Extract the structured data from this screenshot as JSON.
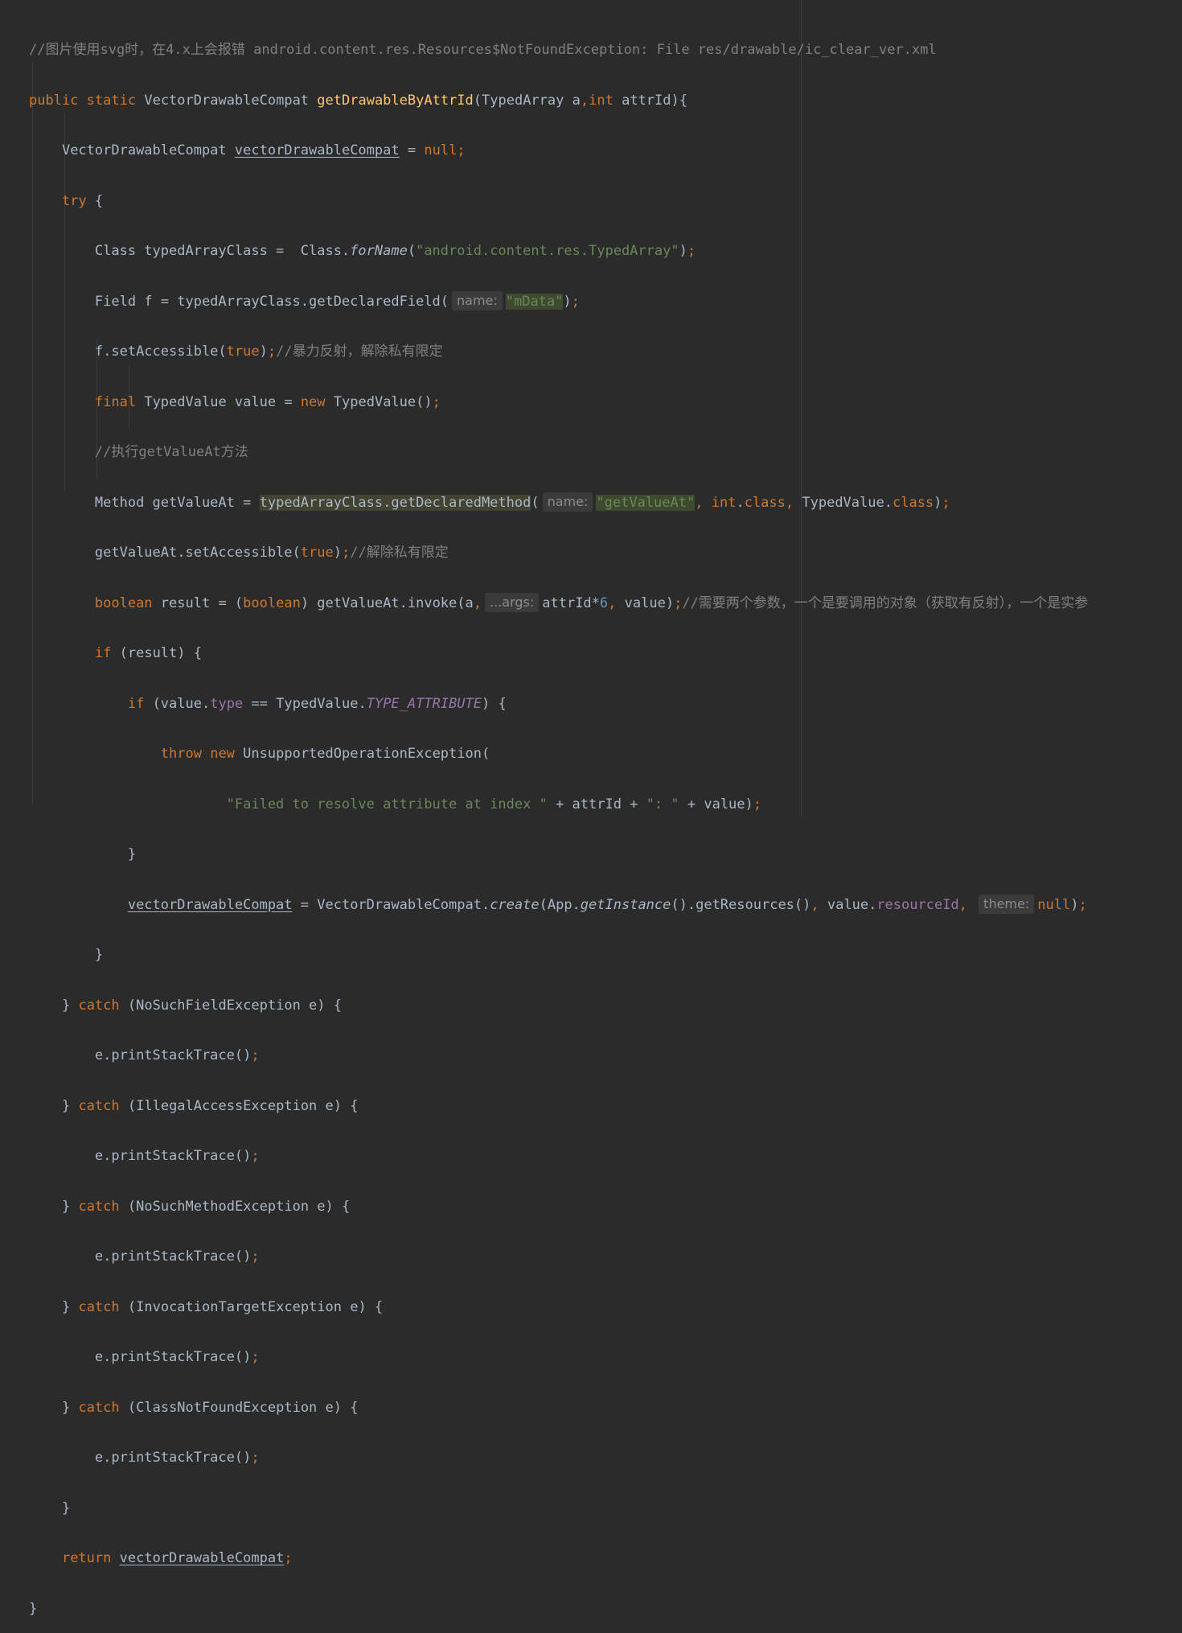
{
  "editor": {
    "l1": {
      "comment": "//图片使用svg时，在4.x上会报错 android.content.res.Resources$NotFoundException: File res/drawable/ic_clear_ver.xml"
    },
    "l2": {
      "kw_public": "public",
      "kw_static": "static",
      "ret_type": "VectorDrawableCompat",
      "method_name": "getDrawableByAttrId",
      "open_paren": "(",
      "p1_type": "TypedArray",
      "p1_name": "a",
      "comma": ",",
      "kw_int": "int",
      "p2_name": "attrId",
      "close": "){"
    },
    "l3": {
      "type": "VectorDrawableCompat",
      "var": "vectorDrawableCompat",
      "eq": "=",
      "kw_null": "null",
      "semi": ";"
    },
    "l4": {
      "kw_try": "try",
      "brace": "{"
    },
    "l5": {
      "a": "Class typedArrayClass =  Class.",
      "m": "forName",
      "b": "(",
      "s": "\"android.content.res.TypedArray\"",
      "c": ")",
      "semi": ";"
    },
    "l6": {
      "a": "Field f = typedArrayClass.getDeclaredField(",
      "hint": "name:",
      "s": "\"mData\"",
      "c": ")",
      "semi": ";"
    },
    "l7": {
      "a": "f.setAccessible(",
      "kw_true": "true",
      "c": ")",
      "semi": ";",
      "comment": "//暴力反射，解除私有限定"
    },
    "l8": {
      "kw_final": "final",
      "a": "TypedValue value =",
      "kw_new": "new",
      "b": "TypedValue()",
      "semi": ";"
    },
    "l9": {
      "comment": "//执行getValueAt方法"
    },
    "l10": {
      "a": "Method getValueAt =",
      "call": "typedArrayClass.getDeclaredMethod",
      "b": "(",
      "hint": "name:",
      "s": "\"getValueAt\"",
      "comma1": ",",
      "kw_int": "int",
      "dot1": ".",
      "kw_class1": "class",
      "comma2": ",",
      "type2": "TypedValue",
      "dot2": ".",
      "kw_class2": "class",
      "c": ")",
      "semi": ";"
    },
    "l11": {
      "a": "getValueAt.setAccessible(",
      "kw_true": "true",
      "c": ")",
      "semi": ";",
      "comment": "//解除私有限定"
    },
    "l12": {
      "kw_boolean": "boolean",
      "a": "result = (",
      "kw_boolean2": "boolean",
      "b": ") getValueAt.invoke(a",
      "comma": ",",
      "hint": "...args:",
      "c": "attrId*",
      "num": "6",
      "comma2": ",",
      "d": "value)",
      "semi": ";",
      "comment": "//需要两个参数，一个是要调用的对象（获取有反射），一个是实参"
    },
    "l13": {
      "kw_if": "if",
      "a": "(result) {"
    },
    "l14": {
      "kw_if": "if",
      "a": "(value.",
      "fld_type": "type",
      "b": "== TypedValue.",
      "const": "TYPE_ATTRIBUTE",
      "c": ") {"
    },
    "l15": {
      "kw_throw": "throw",
      "kw_new": "new",
      "a": "UnsupportedOperationException("
    },
    "l16": {
      "s1": "\"Failed to resolve attribute at index \"",
      "a": "+ attrId +",
      "s2": "\": \"",
      "b": "+ value)",
      "semi": ";"
    },
    "l17": {
      "brace": "}"
    },
    "l18": {
      "var": "vectorDrawableCompat",
      "a": "= VectorDrawableCompat.",
      "m1": "create",
      "b": "(App.",
      "m2": "getInstance",
      "c": "().getResources()",
      "comma1": ",",
      "d": "value.",
      "fld_res": "resourceId",
      "comma2": ",",
      "hint": "theme:",
      "kw_null": "null",
      "e": ")",
      "semi": ";"
    },
    "l19": {
      "brace": "}"
    },
    "l20": {
      "brace": "}",
      "kw_catch": "catch",
      "a": "(NoSuchFieldException e) {"
    },
    "l21": {
      "a": "e.printStackTrace()",
      "semi": ";"
    },
    "l22": {
      "brace": "}",
      "kw_catch": "catch",
      "a": "(IllegalAccessException e) {"
    },
    "l23": {
      "a": "e.printStackTrace()",
      "semi": ";"
    },
    "l24": {
      "brace": "}",
      "kw_catch": "catch",
      "a": "(NoSuchMethodException e) {"
    },
    "l25": {
      "a": "e.printStackTrace()",
      "semi": ";"
    },
    "l26": {
      "brace": "}",
      "kw_catch": "catch",
      "a": "(InvocationTargetException e) {"
    },
    "l27": {
      "a": "e.printStackTrace()",
      "semi": ";"
    },
    "l28": {
      "brace": "}",
      "kw_catch": "catch",
      "a": "(ClassNotFoundException e) {"
    },
    "l29": {
      "a": "e.printStackTrace()",
      "semi": ";"
    },
    "l30": {
      "brace": "}"
    },
    "l31": {
      "kw_return": "return",
      "var": "vectorDrawableCompat",
      "semi": ";"
    },
    "l32": {
      "brace": "}"
    }
  },
  "colors": {
    "background": "#2b2b2b",
    "default_text": "#a9b7c6",
    "keyword": "#cc7832",
    "method_decl": "#ffc66d",
    "string": "#6a8759",
    "comment": "#808080",
    "number": "#6897bb",
    "field": "#9876aa"
  }
}
